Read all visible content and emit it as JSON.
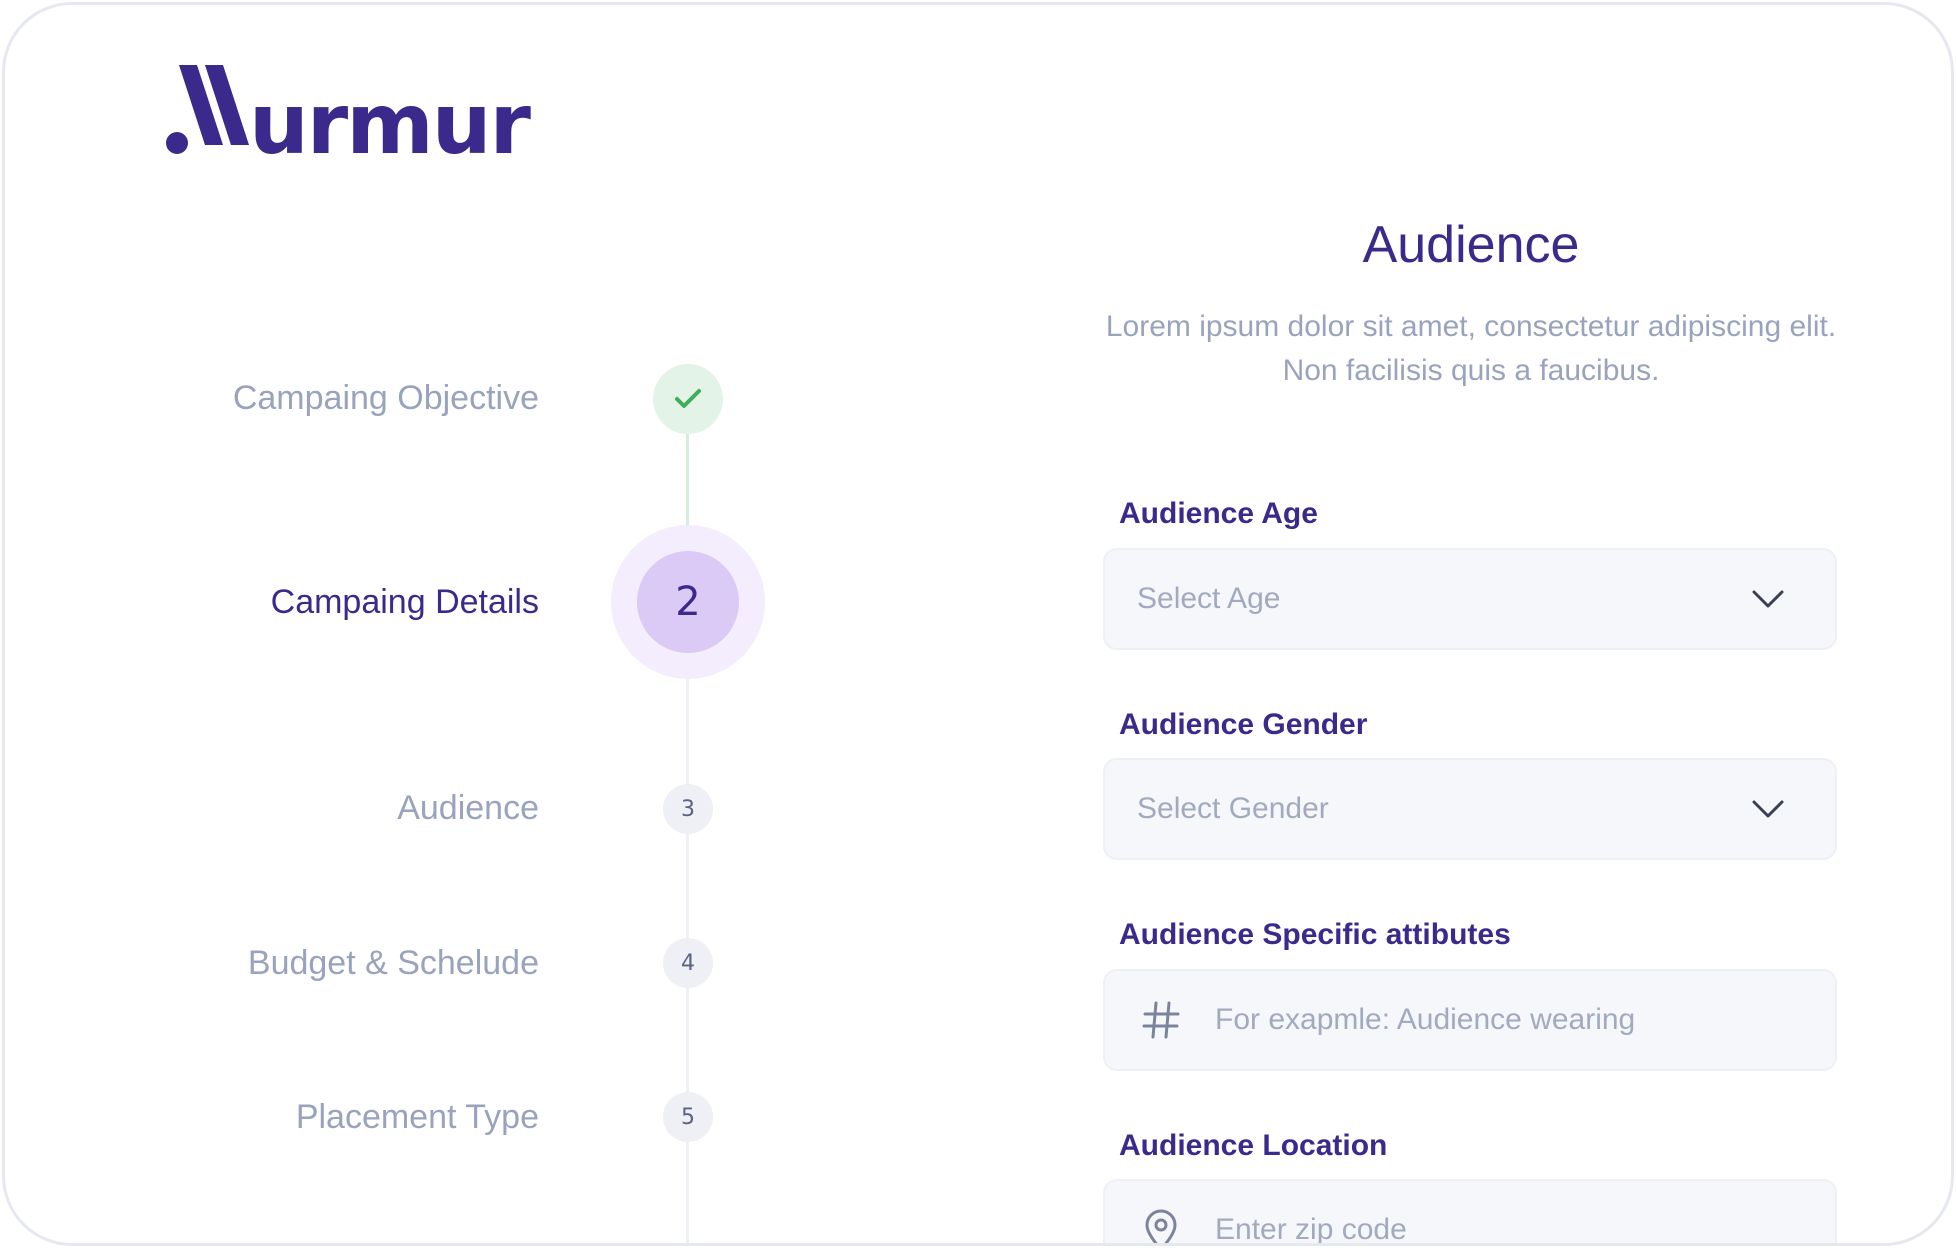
{
  "brand": {
    "name": "Murmur",
    "color": "#3b2a8c"
  },
  "steps": [
    {
      "label": "Campaing Objective",
      "status": "completed",
      "icon": "check-icon"
    },
    {
      "label": "Campaing Details",
      "number": "2",
      "status": "active"
    },
    {
      "label": "Audience",
      "number": "3",
      "status": "pending"
    },
    {
      "label": "Budget & Schelude",
      "number": "4",
      "status": "pending"
    },
    {
      "label": "Placement Type",
      "number": "5",
      "status": "pending"
    }
  ],
  "form": {
    "title": "Audience",
    "description": "Lorem ipsum dolor sit amet, consectetur adipiscing elit. Non facilisis quis a faucibus.",
    "fields": {
      "age": {
        "label": "Audience Age",
        "placeholder": "Select Age",
        "icon": "chevron-down-icon"
      },
      "gender": {
        "label": "Audience Gender",
        "placeholder": "Select Gender",
        "icon": "chevron-down-icon"
      },
      "attributes": {
        "label": "Audience Specific attibutes",
        "placeholder": "For exapmle: Audience wearing",
        "icon": "hashtag-icon"
      },
      "location": {
        "label": "Audience Location",
        "placeholder": "Enter zip code",
        "icon": "location-pin-icon"
      }
    }
  },
  "colors": {
    "accent": "#3b2a8c",
    "muted_text": "#9aa3bd",
    "success_bg": "#e3f3e7",
    "success": "#3fae5a",
    "active_step_bg": "#dbc9f6",
    "field_bg": "#f6f7fb"
  }
}
